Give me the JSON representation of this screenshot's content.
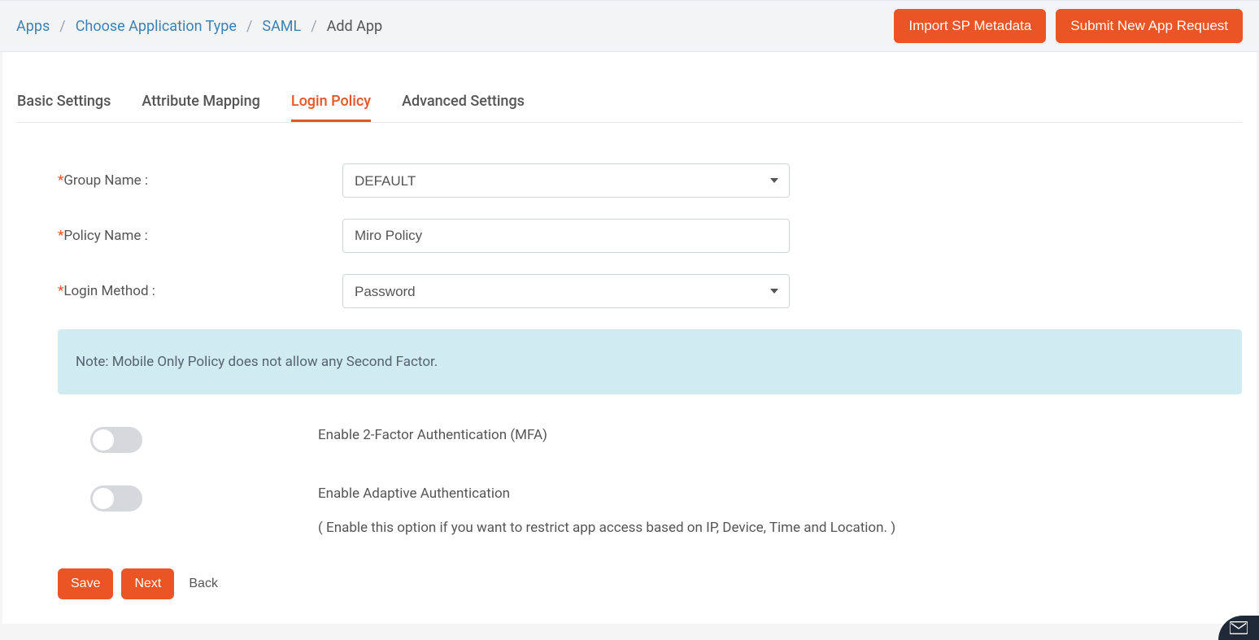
{
  "breadcrumb": {
    "items": [
      {
        "label": "Apps"
      },
      {
        "label": "Choose Application Type"
      },
      {
        "label": "SAML"
      }
    ],
    "current": "Add App"
  },
  "header_actions": {
    "import_metadata": "Import SP Metadata",
    "submit_request": "Submit New App Request"
  },
  "tabs": [
    {
      "label": "Basic Settings",
      "active": false
    },
    {
      "label": "Attribute Mapping",
      "active": false
    },
    {
      "label": "Login Policy",
      "active": true
    },
    {
      "label": "Advanced Settings",
      "active": false
    }
  ],
  "form": {
    "group_name": {
      "label": "Group Name :",
      "value": "DEFAULT"
    },
    "policy_name": {
      "label": "Policy Name :",
      "value": "Miro Policy"
    },
    "login_method": {
      "label": "Login Method :",
      "value": "Password"
    }
  },
  "note": "Note: Mobile Only Policy does not allow any Second Factor.",
  "toggles": {
    "mfa": {
      "label": "Enable 2-Factor Authentication (MFA)"
    },
    "adaptive": {
      "label": "Enable Adaptive Authentication",
      "sub": "( Enable this option if you want to restrict app access based on IP, Device, Time and Location. )"
    }
  },
  "footer": {
    "save": "Save",
    "next": "Next",
    "back": "Back"
  }
}
